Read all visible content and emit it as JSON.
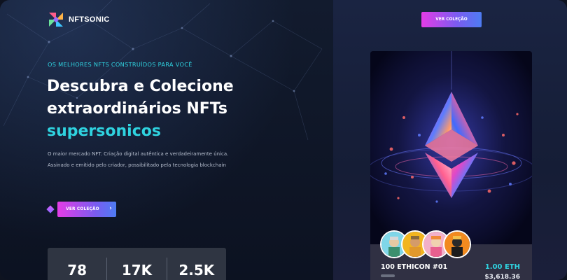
{
  "brand": {
    "name": "NFTSONIC",
    "logo_icon": "pinwheel-logo-icon"
  },
  "hero": {
    "kicker": "OS MELHORES NFTS CONSTRUÍDOS PARA VOCÊ",
    "headline_line1": "Descubra e Colecione",
    "headline_line2": "extraordinários NFTs",
    "headline_accent": "supersonicos",
    "description": "O maior mercado NFT. Criação digital autêntica e verdadeiramente única. Assinado e emitido pelo criador, possibilitado pela tecnologia blockchain",
    "cta_label": "VER COLEÇÃO",
    "cta_icon": "chevron-right-icon"
  },
  "header": {
    "cta_label": "VER COLEÇÃO"
  },
  "stats": [
    {
      "value": "78"
    },
    {
      "value": "17K"
    },
    {
      "value": "2.5K"
    }
  ],
  "nft_card": {
    "name": "100 ETHICON #01",
    "price": "1.00 ETH",
    "usd": "$3,618.36",
    "art_icon": "ethereum-crystal-icon",
    "avatars": [
      "avatar-cyan",
      "avatar-yellow",
      "avatar-pink",
      "avatar-orange"
    ]
  },
  "colors": {
    "accent": "#2fd3e0",
    "gradient_start": "#e43ce6",
    "gradient_end": "#4d7cf2"
  }
}
